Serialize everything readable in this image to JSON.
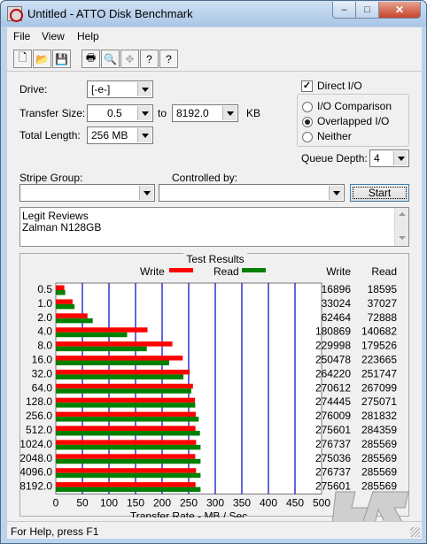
{
  "window": {
    "title": "Untitled - ATTO Disk Benchmark",
    "minimize_glyph": "–",
    "maximize_glyph": "□",
    "close_glyph": "✕"
  },
  "menu": [
    "File",
    "View",
    "Help"
  ],
  "toolbar": {
    "buttons": [
      {
        "name": "new-icon",
        "glyph": "🗋",
        "enabled": true
      },
      {
        "name": "open-icon",
        "glyph": "📂",
        "enabled": true
      },
      {
        "name": "save-icon",
        "glyph": "💾",
        "enabled": true
      },
      {
        "name": "print-icon",
        "glyph": "🖶",
        "enabled": true
      },
      {
        "name": "print-preview-icon",
        "glyph": "🔍",
        "enabled": true
      },
      {
        "name": "move-icon",
        "glyph": "✥",
        "enabled": false
      },
      {
        "name": "help-icon",
        "glyph": "?",
        "enabled": true
      },
      {
        "name": "context-help-icon",
        "glyph": "?",
        "enabled": true
      }
    ]
  },
  "settings": {
    "drive_label": "Drive:",
    "drive_value": "[-e-]",
    "transfer_size_label": "Transfer Size:",
    "transfer_from": "0.5",
    "to_label": "to",
    "transfer_to": "8192.0",
    "unit_label": "KB",
    "total_length_label": "Total Length:",
    "total_length_value": "256 MB",
    "direct_io_label": "Direct I/O",
    "direct_io_checked": true,
    "io_options": [
      {
        "label": "I/O Comparison",
        "selected": false
      },
      {
        "label": "Overlapped I/O",
        "selected": true
      },
      {
        "label": "Neither",
        "selected": false
      }
    ],
    "queue_depth_label": "Queue Depth:",
    "queue_depth_value": "4",
    "stripe_group_label": "Stripe Group:",
    "stripe_group_value": "",
    "controlled_by_label": "Controlled by:",
    "controlled_by_value": "",
    "start_label": "Start"
  },
  "notes": [
    "Legit Reviews",
    "Zalman N128GB"
  ],
  "results": {
    "title": "Test Results",
    "write_legend": "Write",
    "read_legend": "Read",
    "write_col": "Write",
    "read_col": "Read",
    "write_color": "#ff0000",
    "read_color": "#008000"
  },
  "chart_data": {
    "type": "bar",
    "orientation": "horizontal",
    "title": "Test Results",
    "xlabel": "Transfer Rate - MB / Sec",
    "ylabel": "",
    "xlim": [
      0,
      500
    ],
    "xticks": [
      "0",
      "50",
      "100",
      "150",
      "200",
      "250",
      "300",
      "350",
      "400",
      "450",
      "500"
    ],
    "categories": [
      "0.5",
      "1.0",
      "2.0",
      "4.0",
      "8.0",
      "16.0",
      "32.0",
      "64.0",
      "128.0",
      "256.0",
      "512.0",
      "1024.0",
      "2048.0",
      "4096.0",
      "8192.0"
    ],
    "series": [
      {
        "name": "Write",
        "color": "#ff0000",
        "values": [
          16.1,
          31.5,
          59.6,
          172.5,
          219.3,
          238.8,
          252.0,
          258.0,
          261.7,
          263.2,
          262.8,
          263.9,
          262.3,
          263.9,
          262.8
        ],
        "raw": [
          "16896",
          "33024",
          "62464",
          "180869",
          "229998",
          "250478",
          "264220",
          "270612",
          "274445",
          "276009",
          "275601",
          "276737",
          "275036",
          "276737",
          "275601"
        ]
      },
      {
        "name": "Read",
        "color": "#008000",
        "values": [
          17.7,
          35.3,
          69.5,
          134.2,
          171.2,
          213.3,
          240.1,
          254.8,
          262.3,
          268.8,
          271.2,
          272.3,
          272.3,
          272.3,
          272.3
        ],
        "raw": [
          "18595",
          "37027",
          "72888",
          "140682",
          "179526",
          "223665",
          "251747",
          "267099",
          "275071",
          "281832",
          "284359",
          "285569",
          "285569",
          "285569",
          "285569"
        ]
      }
    ],
    "grid": true,
    "legend": "top"
  },
  "watermark": {
    "text": "Legit Reviews",
    "short": "LR"
  },
  "status": {
    "text": "For Help, press F1"
  }
}
